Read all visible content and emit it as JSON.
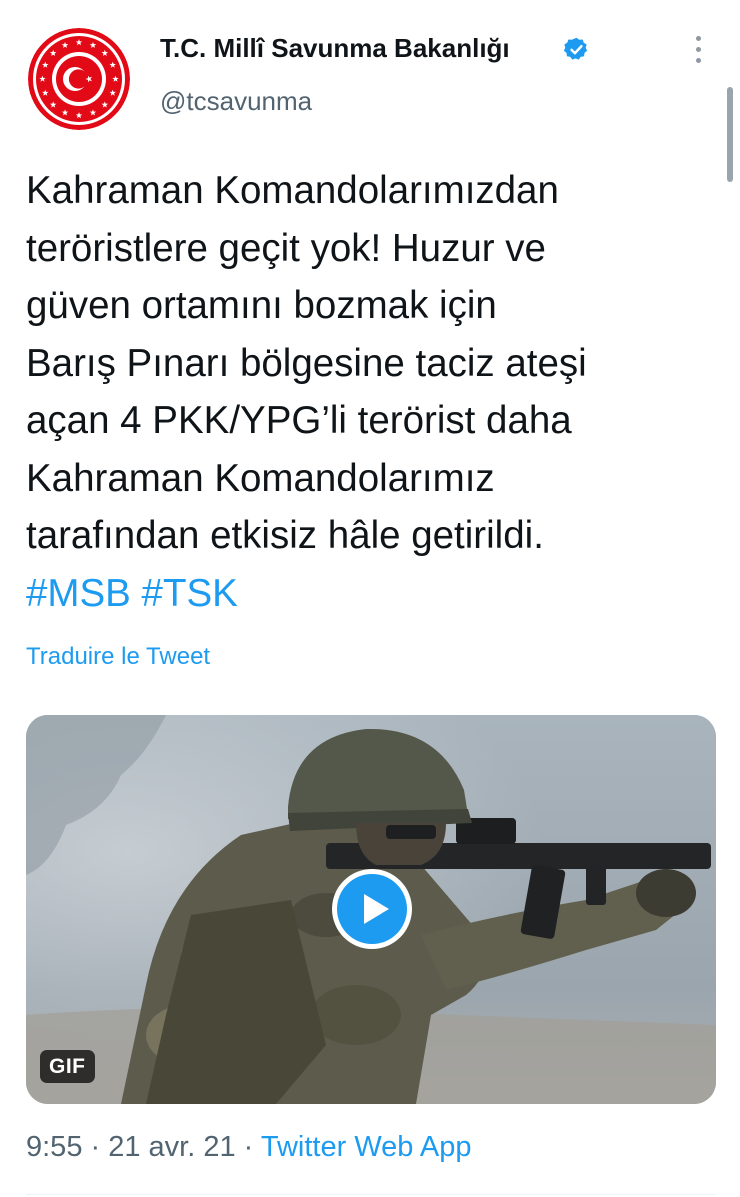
{
  "author": {
    "name": "T.C. Millî Savunma Bakanlığı",
    "handle": "@tcsavunma",
    "verified": true,
    "avatar_icon": "ministry-emblem-icon"
  },
  "tweet": {
    "lines": [
      "Kahraman Komandolarımızdan",
      "teröristlere geçit yok! Huzur ve",
      "güven ortamını bozmak için",
      "Barış Pınarı bölgesine taciz ateşi",
      "açan 4 PKK/YPG’li terörist daha",
      "Kahraman Komandolarımız",
      "tarafından etkisiz hâle getirildi."
    ],
    "hashtags": [
      "#MSB",
      "#TSK"
    ]
  },
  "translate_label": "Traduire le Tweet",
  "media": {
    "badge": "GIF",
    "play_icon": "play-icon"
  },
  "meta": {
    "time": "9:55",
    "sep1": " · ",
    "date": "21 avr. 21",
    "sep2": " · ",
    "source": "Twitter Web App"
  },
  "colors": {
    "accent": "#1d9bf0",
    "secondary_text": "#536471",
    "emblem_red": "#e30a17"
  }
}
